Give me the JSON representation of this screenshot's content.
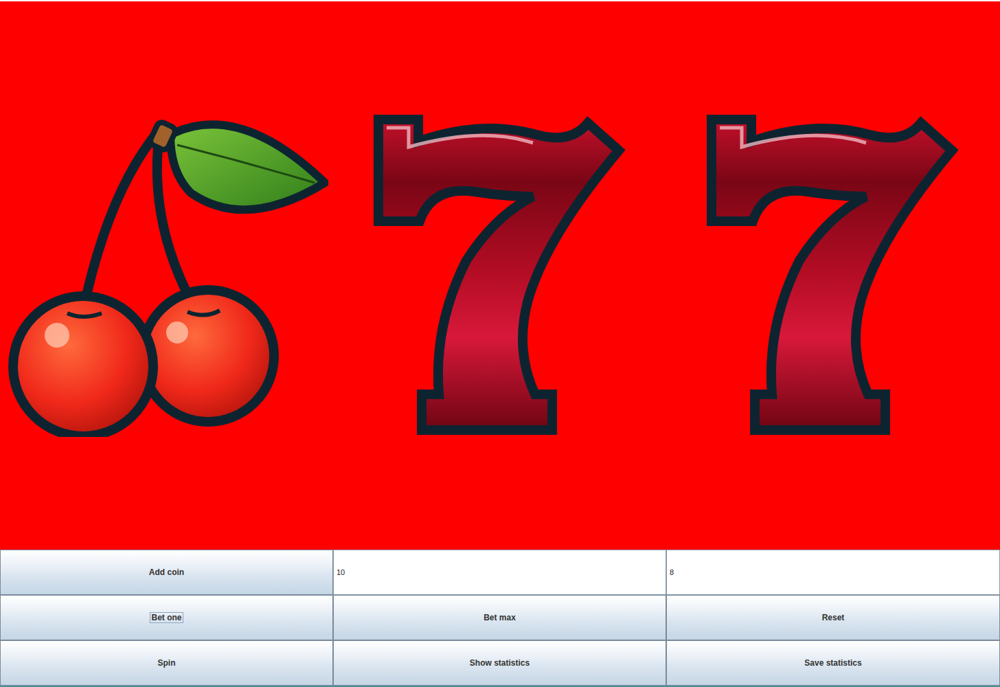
{
  "reels": [
    {
      "kind": "cherry"
    },
    {
      "kind": "seven"
    },
    {
      "kind": "seven"
    }
  ],
  "controls": {
    "rows": [
      [
        {
          "kind": "button",
          "label": "Add coin",
          "focused": false
        },
        {
          "kind": "field",
          "value": "10"
        },
        {
          "kind": "field",
          "value": "8"
        }
      ],
      [
        {
          "kind": "button",
          "label": "Bet one",
          "focused": true
        },
        {
          "kind": "button",
          "label": "Bet max",
          "focused": false
        },
        {
          "kind": "button",
          "label": "Reset",
          "focused": false
        }
      ],
      [
        {
          "kind": "button",
          "label": "Spin",
          "focused": false
        },
        {
          "kind": "button",
          "label": "Show statistics",
          "focused": false
        },
        {
          "kind": "button",
          "label": "Save statistics",
          "focused": false
        }
      ]
    ]
  }
}
